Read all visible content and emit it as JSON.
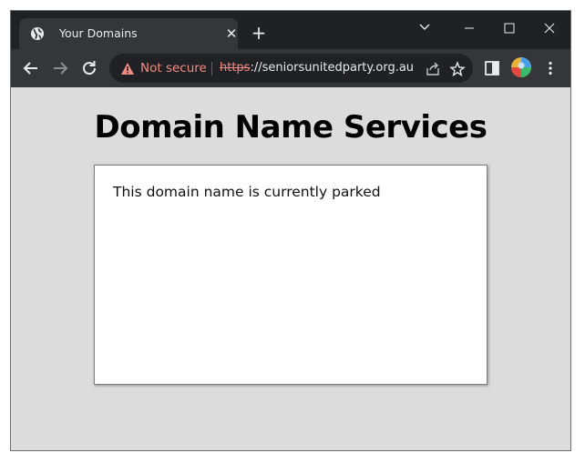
{
  "tab": {
    "title": "Your Domains",
    "close_glyph": "✕",
    "favicon": "globe-icon"
  },
  "newtab": {
    "glyph": "+"
  },
  "omnibox": {
    "security_label": "Not secure",
    "url_scheme": "https",
    "url_rest": "://seniorsunitedparty.org.au"
  },
  "page": {
    "heading": "Domain Name Services",
    "message": "This domain name is currently parked"
  },
  "colors": {
    "titlebar": "#202124",
    "toolbar": "#35363a",
    "not_secure": "#f28b82",
    "page_bg": "#dcdcdc"
  }
}
